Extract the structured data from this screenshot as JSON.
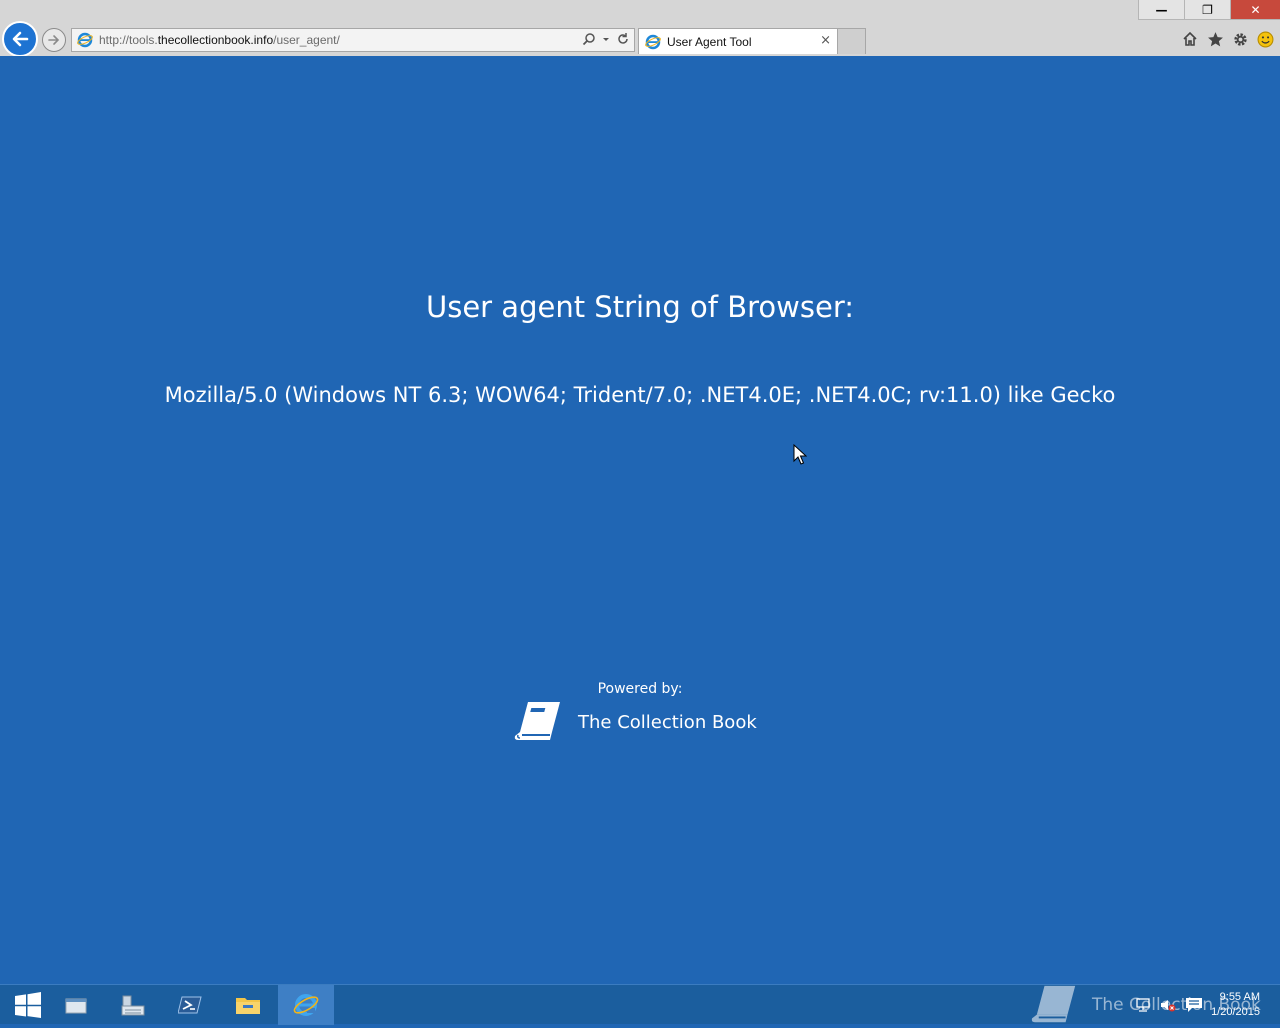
{
  "browser": {
    "url_prefix": "http://tools.",
    "url_host": "thecollectionbook.info",
    "url_path": "/user_agent/",
    "tab_title": "User Agent Tool",
    "tab_close": "×",
    "window_controls": {
      "minimize": "—",
      "restore": "❐",
      "close": "✕"
    }
  },
  "page": {
    "heading": "User agent String of Browser:",
    "user_agent": "Mozilla/5.0 (Windows NT 6.3; WOW64; Trident/7.0; .NET4.0E; .NET4.0C; rv:11.0) like Gecko",
    "powered_label": "Powered by:",
    "brand_name": "The Collection Book"
  },
  "taskbar": {
    "watermark": "The Collection Book",
    "time": "9:55 AM",
    "date": "1/20/2015"
  },
  "colors": {
    "page_bg": "#2066b4",
    "taskbar_bg": "#1b5e9e",
    "back_button": "#1e73d2",
    "close_button": "#c7493c"
  },
  "icons": [
    "back-arrow-icon",
    "forward-arrow-icon",
    "ie-icon",
    "search-icon",
    "refresh-icon",
    "home-icon",
    "favorites-star-icon",
    "gear-icon",
    "smiley-icon",
    "book-icon",
    "windows-start-icon",
    "folder-icon",
    "powershell-icon",
    "explorer-icon",
    "server-manager-icon",
    "network-icon",
    "volume-icon",
    "action-center-icon"
  ]
}
